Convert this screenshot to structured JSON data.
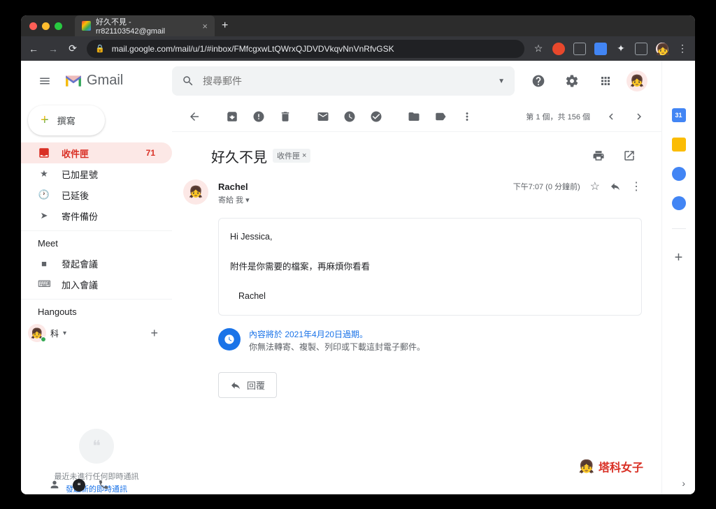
{
  "browser": {
    "tab_title": "好久不見 - rr821103542@gmail",
    "url": "mail.google.com/mail/u/1/#inbox/FMfcgxwLtQWrxQJDVDVkqvNnVnRfvGSK"
  },
  "header": {
    "app_name": "Gmail",
    "search_placeholder": "搜尋郵件"
  },
  "compose": "撰寫",
  "nav": {
    "inbox": "收件匣",
    "inbox_count": "71",
    "starred": "已加星號",
    "snoozed": "已延後",
    "sent": "寄件備份"
  },
  "meet": {
    "title": "Meet",
    "start": "發起會議",
    "join": "加入會議"
  },
  "hangouts": {
    "title": "Hangouts",
    "user": "科",
    "empty_line1": "最近未進行任何即時通訊",
    "empty_line2": "發起新的即時通訊"
  },
  "pagination": "第 1 個，共 156 個",
  "email": {
    "subject": "好久不見",
    "label": "收件匣",
    "sender": "Rachel",
    "to": "寄給 我",
    "timestamp": "下午7:07 (0 分鐘前)",
    "body_line1": "Hi Jessica,",
    "body_line2": "附件是你需要的檔案，再麻煩你看看",
    "body_line3": "Rachel",
    "confidential_line1": "內容將於 2021年4月20日過期。",
    "confidential_line2": "你無法轉寄、複製、列印或下載這封電子郵件。",
    "reply": "回覆"
  },
  "brand": "塔科女子"
}
